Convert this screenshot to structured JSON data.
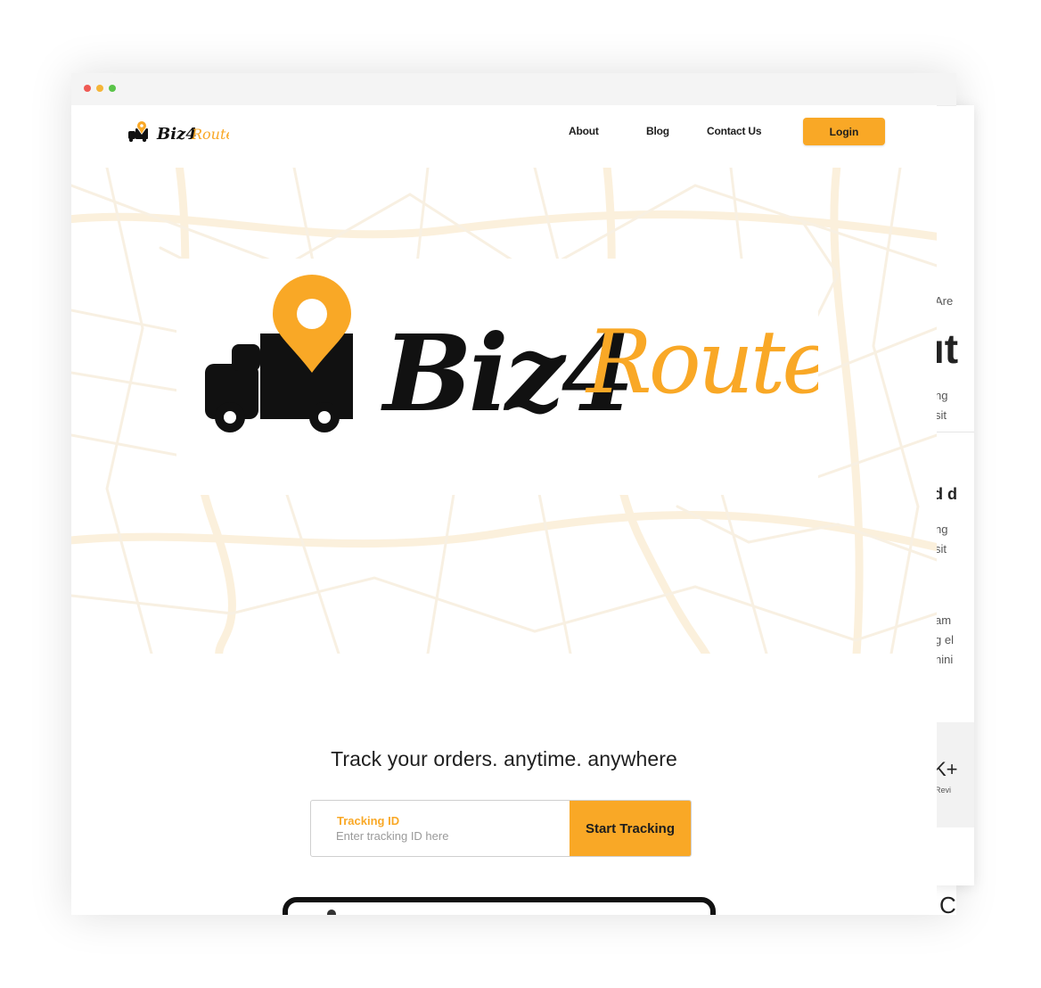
{
  "window": {
    "controls": [
      "close",
      "minimize",
      "maximize"
    ]
  },
  "brand": {
    "name_part1": "Biz4",
    "name_part2": "Route",
    "colors": {
      "accent": "#f9a826",
      "dark": "#111111"
    },
    "logo_icon": "truck-location-pin-icon"
  },
  "nav": {
    "links": [
      "About",
      "Blog",
      "Contact Us"
    ],
    "login_label": "Login"
  },
  "hero": {
    "tagline": "Track your orders. anytime. anywhere",
    "tracking": {
      "label": "Tracking ID",
      "placeholder": "Enter tracking ID here",
      "button_label": "Start Tracking"
    }
  },
  "background_page_fragments": [
    "Are",
    "ıt",
    "ng",
    "sit",
    "d d",
    "ng",
    "sit",
    "am",
    "g el",
    "nini",
    "K+",
    "Revi",
    "C"
  ],
  "map_background": "street-map-pattern"
}
